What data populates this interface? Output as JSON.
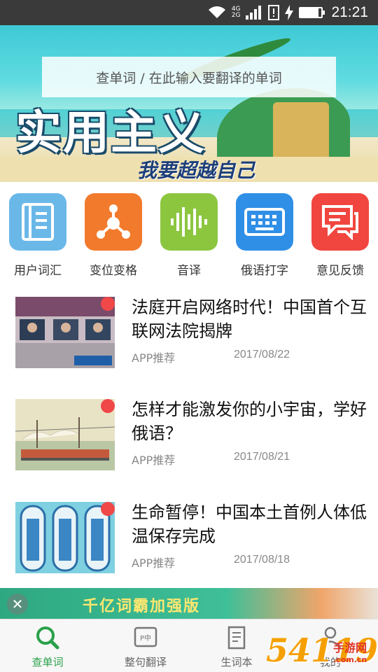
{
  "status_bar": {
    "network_top": "4G",
    "network_bottom": "2G",
    "time": "21:21",
    "battery_level": 0.85
  },
  "banner": {
    "search_placeholder": "查单词 / 在此输入要翻译的单词",
    "title": "实用主义",
    "subtitle": "我要超越自己"
  },
  "features": [
    {
      "label": "用户词汇",
      "icon": "notebook-icon",
      "color": "#6ab8e8"
    },
    {
      "label": "变位变格",
      "icon": "molecule-icon",
      "color": "#f27a2c"
    },
    {
      "label": "音译",
      "icon": "sound-wave-icon",
      "color": "#8cc63f"
    },
    {
      "label": "俄语打字",
      "icon": "keyboard-icon",
      "color": "#2f8fe6"
    },
    {
      "label": "意见反馈",
      "icon": "feedback-icon",
      "color": "#f0463f"
    }
  ],
  "articles": [
    {
      "title": "法庭开启网络时代！中国首个互联网法院揭牌",
      "category": "APP推荐",
      "date": "2017/08/22"
    },
    {
      "title": "怎样才能激发你的小宇宙，学好俄语？",
      "category": "APP推荐",
      "date": "2017/08/21"
    },
    {
      "title": "生命暂停！中国本土首例人体低温保存完成",
      "category": "APP推荐",
      "date": "2017/08/18"
    }
  ],
  "promo": {
    "text": "千亿词霸加强版"
  },
  "bottom_nav": [
    {
      "label": "查单词",
      "icon": "search-icon",
      "active": true
    },
    {
      "label": "整句翻译",
      "icon": "sentence-translate-icon",
      "active": false
    },
    {
      "label": "生词本",
      "icon": "wordbook-icon",
      "active": false
    },
    {
      "label": "我的",
      "icon": "user-icon",
      "active": false
    }
  ],
  "watermark": {
    "big": "54119",
    "small": "手游网",
    "url": ".com.cn"
  },
  "colors": {
    "accent_green": "#2aa14a",
    "badge_red": "#f04848"
  }
}
